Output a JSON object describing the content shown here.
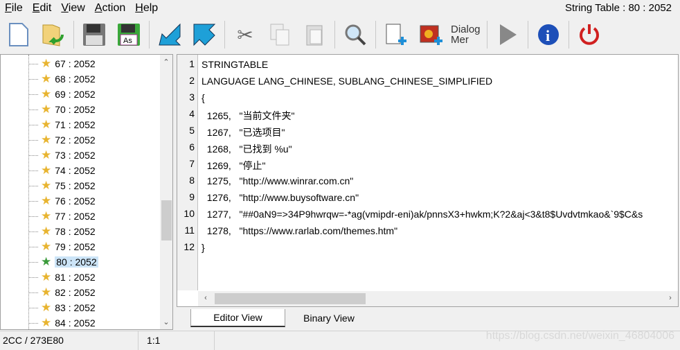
{
  "window": {
    "title": "String Table : 80 : 2052"
  },
  "menu": [
    {
      "key": "F",
      "rest": "ile"
    },
    {
      "key": "E",
      "rest": "dit"
    },
    {
      "key": "V",
      "rest": "iew"
    },
    {
      "key": "A",
      "rest": "ction"
    },
    {
      "key": "H",
      "rest": "elp"
    }
  ],
  "toolbar": {
    "dialog_merge_label": "Dialog Mer"
  },
  "tree": {
    "items": [
      "67 : 2052",
      "68 : 2052",
      "69 : 2052",
      "70 : 2052",
      "71 : 2052",
      "72 : 2052",
      "73 : 2052",
      "74 : 2052",
      "75 : 2052",
      "76 : 2052",
      "77 : 2052",
      "78 : 2052",
      "79 : 2052",
      "80 : 2052",
      "81 : 2052",
      "82 : 2052",
      "83 : 2052",
      "84 : 2052"
    ],
    "selected": "80 : 2052"
  },
  "editor": {
    "lines": [
      "STRINGTABLE",
      "LANGUAGE LANG_CHINESE, SUBLANG_CHINESE_SIMPLIFIED",
      "{",
      "  1265,   \"当前文件夹\"",
      "  1267,   \"已选项目\"",
      "  1268,   \"已找到 %u\"",
      "  1269,   \"停止\"",
      "  1275,   \"http://www.winrar.com.cn\"",
      "  1276,   \"http://www.buysoftware.cn\"",
      "  1277,   \"##0aN9=>34P9hwrqw=-*ag(vmipdr-eni)ak/pnnsX3+hwkm;K?2&aj<3&t8$Uvdvtmkao&`9$C&s",
      "  1278,   \"https://www.rarlab.com/themes.htm\"",
      "}"
    ],
    "line_numbers": [
      "1",
      "2",
      "3",
      "4",
      "5",
      "6",
      "7",
      "8",
      "9",
      "10",
      "11",
      "12"
    ]
  },
  "tabs": [
    {
      "label": "Editor View",
      "active": true
    },
    {
      "label": "Binary View",
      "active": false
    }
  ],
  "status": {
    "offset": "2CC / 273E80",
    "position": "1:1"
  },
  "watermark": "https://blog.csdn.net/weixin_46804006"
}
